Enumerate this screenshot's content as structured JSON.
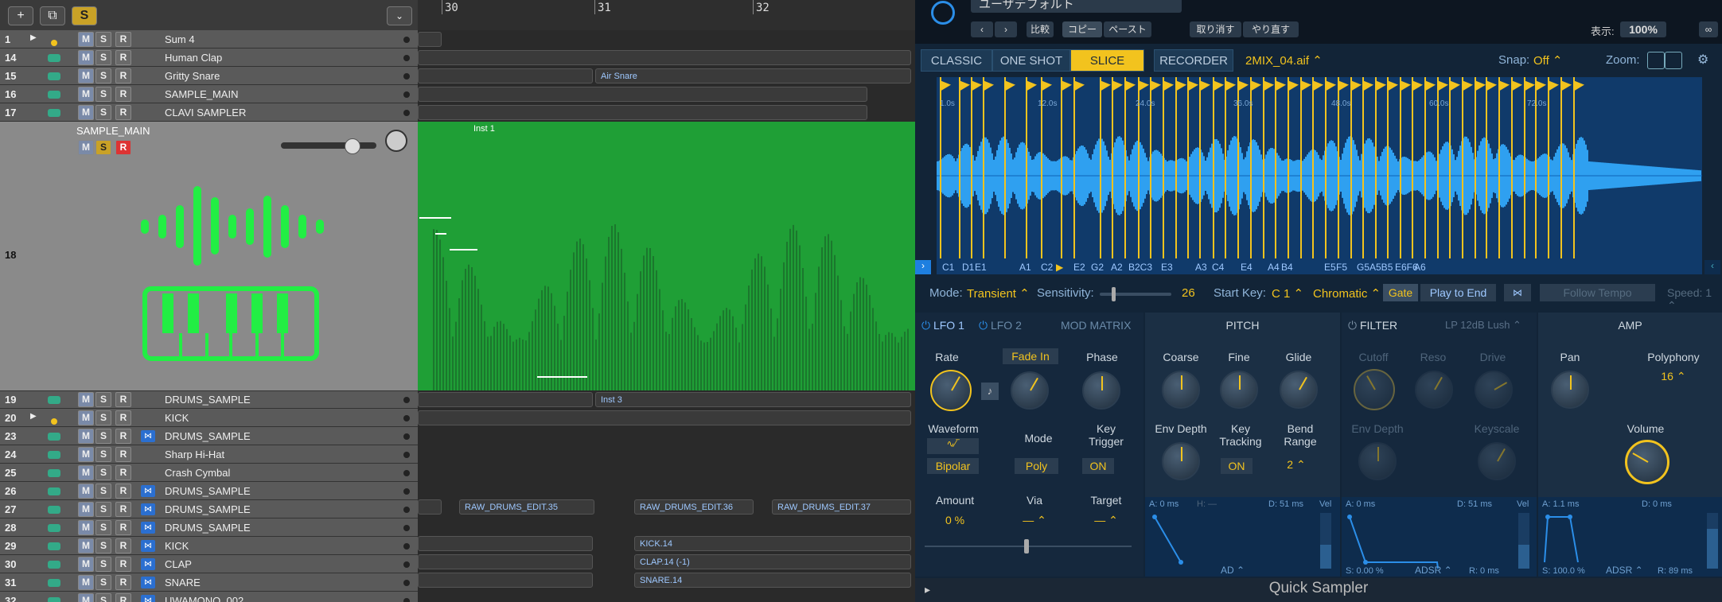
{
  "toolbar": {
    "add_icon": "+",
    "duplicate_icon": "⧉",
    "solo_label": "S",
    "collapse_icon": "⌄"
  },
  "ruler": {
    "bars": [
      "30",
      "31",
      "32"
    ]
  },
  "tracks": [
    {
      "num": "1",
      "name": "Sum 4"
    },
    {
      "num": "14",
      "name": "Human Clap"
    },
    {
      "num": "15",
      "name": "Gritty Snare"
    },
    {
      "num": "16",
      "name": "SAMPLE_MAIN"
    },
    {
      "num": "17",
      "name": "CLAVI SAMPLER"
    },
    {
      "num": "18",
      "name": "SAMPLE_MAIN"
    },
    {
      "num": "19",
      "name": "DRUMS_SAMPLE"
    },
    {
      "num": "20",
      "name": "KICK"
    },
    {
      "num": "23",
      "name": "DRUMS_SAMPLE"
    },
    {
      "num": "24",
      "name": "Sharp Hi-Hat"
    },
    {
      "num": "25",
      "name": "Crash Cymbal"
    },
    {
      "num": "26",
      "name": "DRUMS_SAMPLE"
    },
    {
      "num": "27",
      "name": "DRUMS_SAMPLE"
    },
    {
      "num": "28",
      "name": "DRUMS_SAMPLE"
    },
    {
      "num": "29",
      "name": "KICK"
    },
    {
      "num": "30",
      "name": "CLAP"
    },
    {
      "num": "31",
      "name": "SNARE"
    },
    {
      "num": "32",
      "name": "UWAMONO_002"
    }
  ],
  "msr": {
    "m": "M",
    "s": "S",
    "r": "R"
  },
  "regions": {
    "air_snare": "Air Snare",
    "inst1": "Inst 1",
    "inst3": "Inst 3",
    "raw35": "RAW_DRUMS_EDIT.35",
    "raw36": "RAW_DRUMS_EDIT.36",
    "raw37": "RAW_DRUMS_EDIT.37",
    "kick14": "KICK.14",
    "clap14": "CLAP.14 (-1)",
    "snare14": "SNARE.14"
  },
  "sampler": {
    "preset": "ユーザデフォルト",
    "compare": "比較",
    "copy": "コピー",
    "paste": "ペースト",
    "undo": "取り消す",
    "redo": "やり直す",
    "display_label": "表示:",
    "zoom_value": "100%",
    "modes": [
      "CLASSIC",
      "ONE SHOT",
      "SLICE",
      "RECORDER"
    ],
    "active_mode": "SLICE",
    "filename": "2MIX_04.aif ⌃",
    "snap_label": "Snap:",
    "snap_value": "Off ⌃",
    "zoom_label": "Zoom:",
    "time_marks": [
      "1.0s",
      "12.0s",
      "24.0s",
      "36.0s",
      "48.0s",
      "60.0s",
      "72.0s"
    ],
    "slice_labels": [
      "C1",
      "D1",
      "E1",
      "A1",
      "C2",
      "E2",
      "G2",
      "A2",
      "B2C3",
      "E3",
      "A3",
      "C4",
      "E4",
      "A4",
      "B4",
      "E5",
      "F5",
      "G5A5B5",
      "E6F6",
      "A6"
    ],
    "mode_label": "Mode:",
    "mode_value": "Transient ⌃",
    "sensitivity_label": "Sensitivity:",
    "sensitivity_value": "26",
    "start_key_label": "Start Key:",
    "start_key_value": "C 1 ⌃",
    "chromatic": "Chromatic ⌃",
    "gate": "Gate",
    "play_to_end": "Play to End",
    "follow_tempo": "Follow Tempo",
    "speed": "Speed: 1 ⌃",
    "footer_title": "Quick Sampler",
    "accent_color": "#f2c31e"
  },
  "mod": {
    "lfo1": "LFO 1",
    "lfo2": "LFO 2",
    "mod_matrix": "MOD MATRIX",
    "rate": "Rate",
    "fade_in": "Fade In",
    "phase": "Phase",
    "waveform": "Waveform",
    "mode": "Mode",
    "key_trigger": "Key\nTrigger",
    "bipolar": "Bipolar",
    "poly": "Poly",
    "on": "ON",
    "amount": "Amount",
    "amount_value": "0 %",
    "via": "Via",
    "via_value": "— ⌃",
    "target": "Target",
    "target_value": "— ⌃"
  },
  "pitch": {
    "title": "PITCH",
    "coarse": "Coarse",
    "fine": "Fine",
    "glide": "Glide",
    "env_depth": "Env Depth",
    "key_tracking": "Key\nTracking",
    "bend_range": "Bend\nRange",
    "key_tracking_value": "ON",
    "bend_value": "2 ⌃",
    "env_a": "A: 0 ms",
    "env_h": "H: —",
    "env_d": "D: 51 ms",
    "env_vel": "Vel",
    "env_type": "AD ⌃"
  },
  "filter": {
    "title": "FILTER",
    "type": "LP 12dB Lush ⌃",
    "cutoff": "Cutoff",
    "reso": "Reso",
    "drive": "Drive",
    "env_depth": "Env Depth",
    "keyscale": "Keyscale",
    "env_a": "A: 0 ms",
    "env_d": "D: 51 ms",
    "env_s": "S: 0.00 %",
    "env_r": "R: 0 ms",
    "env_type": "ADSR ⌃",
    "env_vel": "Vel"
  },
  "amp": {
    "title": "AMP",
    "pan": "Pan",
    "polyphony": "Polyphony",
    "polyphony_value": "16 ⌃",
    "volume": "Volume",
    "env_a": "A: 1.1 ms",
    "env_d": "D: 0 ms",
    "env_s": "S: 100.0 %",
    "env_r": "R: 89 ms",
    "env_type": "ADSR ⌃",
    "env_vel": "Vel"
  },
  "inst_panel": {
    "name": "SAMPLE_MAIN"
  }
}
